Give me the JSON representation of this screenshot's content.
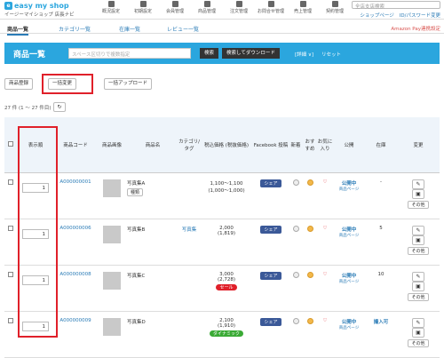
{
  "brand": {
    "logo": "easy my shop",
    "sub": "イージーマイショップ 店長ナビ"
  },
  "topnav": [
    "概況設定",
    "初期設定",
    "会員管理",
    "商品管理",
    "注文管理",
    "お問合せ管理",
    "売上管理",
    "契約管理",
    "ヘルプ"
  ],
  "top_search": {
    "placeholder": "全店支店検索"
  },
  "shop_links": [
    "ショップページ",
    "ID/パスワード変更"
  ],
  "subnav": {
    "items": [
      "商品一覧",
      "カテゴリ一覧",
      "在庫一覧",
      "レビュー一覧"
    ],
    "amazon": "Amazon Pay連携設定"
  },
  "header": {
    "title": "商品一覧",
    "search_placeholder": "スペース区切りで複数指定",
    "search_btn": "検索",
    "download_btn": "検索してダウンロード",
    "detail": "[詳細 ∨]",
    "reset": "リセット"
  },
  "actions": {
    "register": "商品登録",
    "bulk_change": "一括変更",
    "bulk_upload": "一括アップロード"
  },
  "count": "27 件 (1 ～ 27 件目)",
  "columns": {
    "order": "表示順",
    "code": "商品コード",
    "image": "商品画像",
    "name": "商品名",
    "category": "カテゴリ/タグ",
    "price": "税込価格 (税抜価格)",
    "facebook": "Facebook 投稿",
    "new": "新着",
    "recommend": "おすすめ",
    "favorite": "お気に入り",
    "public": "公開",
    "stock": "在庫",
    "change": "変更"
  },
  "rows": [
    {
      "order": "1",
      "code": "A000000001",
      "name": "写真集A",
      "type_btn": "種類",
      "category": "",
      "price": "1,100～1,100",
      "price_ex": "(1,000～1,000)",
      "fb": "シェア",
      "public": "公開中",
      "public_sub": "商品ページ",
      "stock": "-",
      "tag": "",
      "other": "その他"
    },
    {
      "order": "1",
      "code": "A000000006",
      "name": "写真集B",
      "type_btn": "",
      "category": "写真集",
      "price": "2,000",
      "price_ex": "(1,819)",
      "fb": "シェア",
      "public": "公開中",
      "public_sub": "商品ページ",
      "stock": "5",
      "tag": "",
      "other": "その他"
    },
    {
      "order": "1",
      "code": "A000000008",
      "name": "写真集C",
      "type_btn": "",
      "category": "",
      "price": "3,000",
      "price_ex": "(2,728)",
      "fb": "シェア",
      "public": "公開中",
      "public_sub": "商品ページ",
      "stock": "10",
      "tag": "セール",
      "other": "その他"
    },
    {
      "order": "1",
      "code": "A000000009",
      "name": "写真集D",
      "type_btn": "",
      "category": "",
      "price": "2,100",
      "price_ex": "(1,910)",
      "fb": "シェア",
      "public": "公開中",
      "public_sub": "商品ページ",
      "stock": "撮入可",
      "tag": "ダイナミック",
      "other": "その他"
    }
  ],
  "colors": {
    "accent": "#2ba6de",
    "red_box": "#e0202a",
    "sale": "#e0202a",
    "dynamic": "#3aaa35"
  }
}
